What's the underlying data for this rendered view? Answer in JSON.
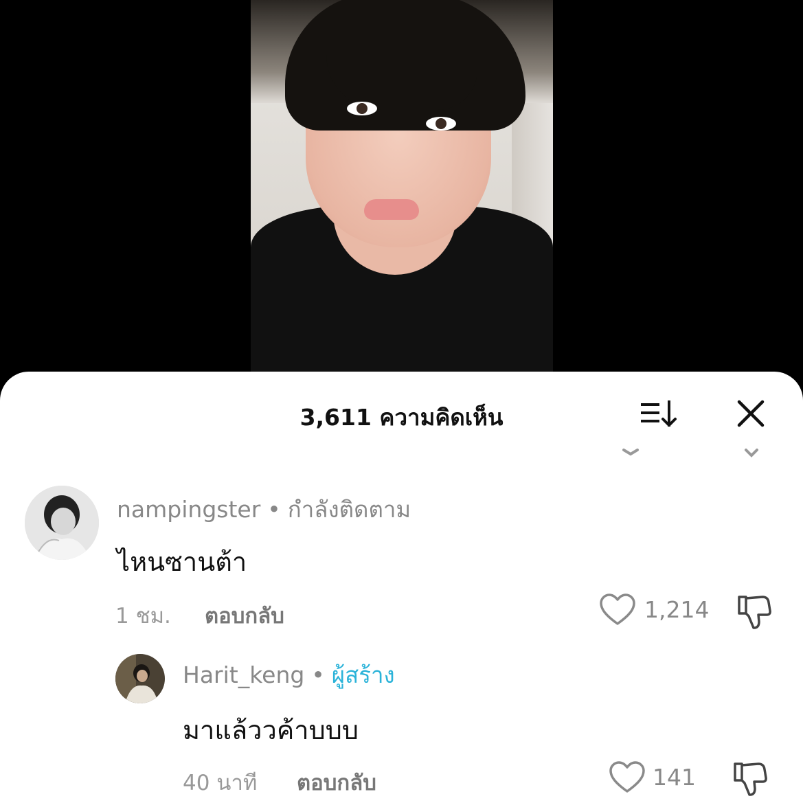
{
  "sheet": {
    "title": "3,611 ความคิดเห็น",
    "sort_icon": "sort-icon",
    "close_icon": "close-icon"
  },
  "comments": [
    {
      "username": "nampingster",
      "separator": "•",
      "tag": "กำลังติดตาม",
      "text": "ไหนซานต้า",
      "time": "1 ชม.",
      "reply_label": "ตอบกลับ",
      "likes": "1,214"
    }
  ],
  "replies": [
    {
      "username": "Harit_keng",
      "separator": "•",
      "tag": "ผู้สร้าง",
      "text": "มาแล้ววค้าบบบ",
      "time": "40 นาที",
      "reply_label": "ตอบกลับ",
      "likes": "141"
    }
  ],
  "colors": {
    "creator": "#2bb3d9",
    "muted": "#888888",
    "text": "#111111"
  }
}
